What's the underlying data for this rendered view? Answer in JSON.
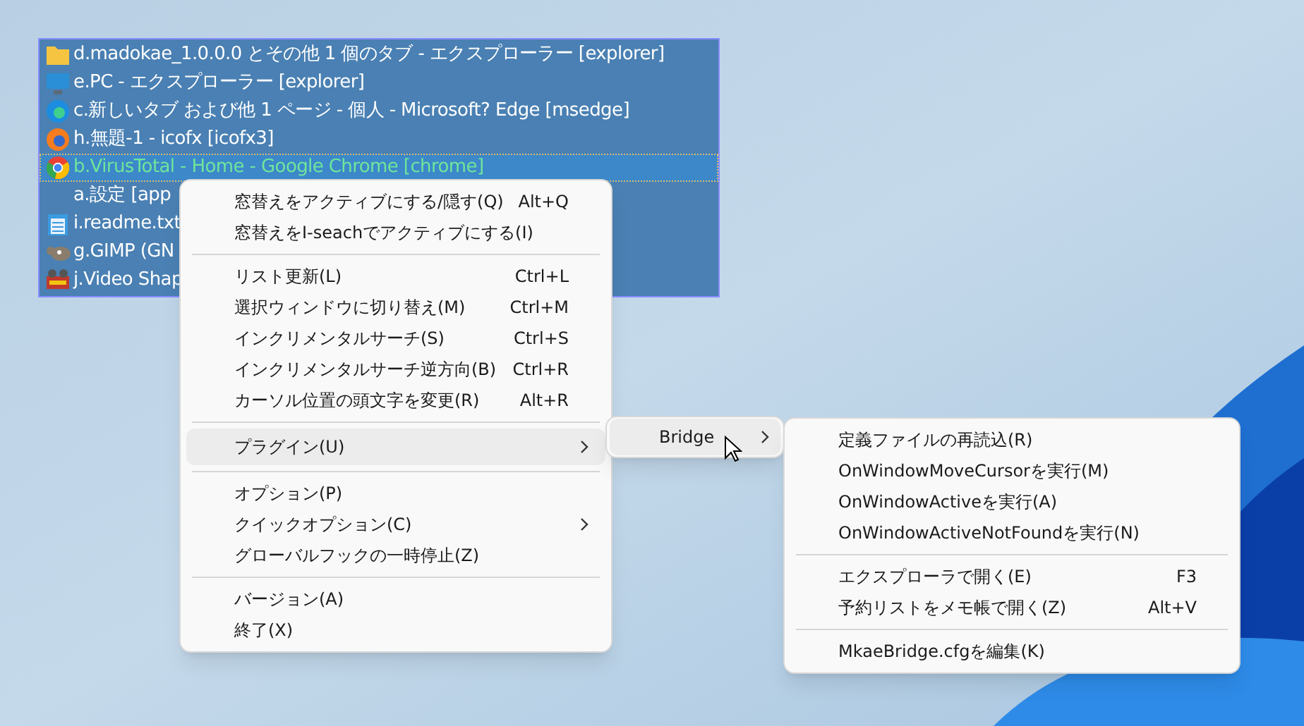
{
  "window_list": {
    "rows": [
      {
        "text": "d.madokae_1.0.0.0 とその他 1 個のタブ - エクスプローラー [explorer]",
        "selected": false
      },
      {
        "text": "e.PC - エクスプローラー [explorer]",
        "selected": false
      },
      {
        "text": "c.新しいタブ および他 1 ページ - 個人 - Microsoft​? Edge [msedge]",
        "selected": false
      },
      {
        "text": "h.無題-1 - icofx [icofx3]",
        "selected": false
      },
      {
        "text": "b.VirusTotal - Home - Google Chrome [chrome]",
        "selected": true
      },
      {
        "text": "a.設定 [app",
        "selected": false
      },
      {
        "text": "i.readme.txt",
        "selected": false
      },
      {
        "text": "g.GIMP (GN",
        "selected": false
      },
      {
        "text": "j.Video Shap",
        "selected": false
      }
    ]
  },
  "context_menu": {
    "groups": [
      [
        {
          "label": "窓替えをアクティブにする/隠す(Q)",
          "shortcut": "Alt+Q",
          "submenu": false,
          "selected": false
        },
        {
          "label": "窓替えをI-seachでアクティブにする(I)",
          "submenu": false,
          "selected": false
        }
      ],
      [
        {
          "label": "リスト更新(L)",
          "shortcut": "Ctrl+L",
          "submenu": false,
          "selected": false
        },
        {
          "label": "選択ウィンドウに切り替え(M)",
          "shortcut": "Ctrl+M",
          "submenu": false,
          "selected": false
        },
        {
          "label": "インクリメンタルサーチ(S)",
          "shortcut": "Ctrl+S",
          "submenu": false,
          "selected": false
        },
        {
          "label": "インクリメンタルサーチ逆方向(B)",
          "shortcut": "Ctrl+R",
          "submenu": false,
          "selected": false
        },
        {
          "label": "カーソル位置の頭文字を変更(R)",
          "shortcut": "Alt+R",
          "submenu": false,
          "selected": false
        }
      ],
      [
        {
          "label": "プラグイン(U)",
          "submenu": true,
          "selected": true
        }
      ],
      [
        {
          "label": "オプション(P)",
          "submenu": false,
          "selected": false
        },
        {
          "label": "クイックオプション(C)",
          "submenu": true,
          "selected": false
        },
        {
          "label": "グローバルフックの一時停止(Z)",
          "submenu": false,
          "selected": false
        }
      ],
      [
        {
          "label": "バージョン(A)",
          "submenu": false,
          "selected": false
        },
        {
          "label": "終了(X)",
          "submenu": false,
          "selected": false
        }
      ]
    ]
  },
  "plugin_menu": {
    "items": [
      {
        "label": "Bridge",
        "submenu": true,
        "selected": true
      }
    ]
  },
  "bridge_menu": {
    "groups": [
      [
        {
          "label": "定義ファイルの再読込(R)",
          "submenu": false,
          "selected": false
        },
        {
          "label": "OnWindowMoveCursorを実行(M)",
          "submenu": false,
          "selected": false
        },
        {
          "label": "OnWindowActiveを実行(A)",
          "submenu": false,
          "selected": false
        },
        {
          "label": "OnWindowActiveNotFoundを実行(N)",
          "submenu": false,
          "selected": false
        }
      ],
      [
        {
          "label": "エクスプローラで開く(E)",
          "shortcut": "F3",
          "submenu": false,
          "selected": false
        },
        {
          "label": "予約リストをメモ帳で開く(Z)",
          "shortcut": "Alt+V",
          "submenu": false,
          "selected": false
        }
      ],
      [
        {
          "label": "MkaeBridge.cfgを編集(K)",
          "submenu": false,
          "selected": false
        }
      ]
    ]
  }
}
